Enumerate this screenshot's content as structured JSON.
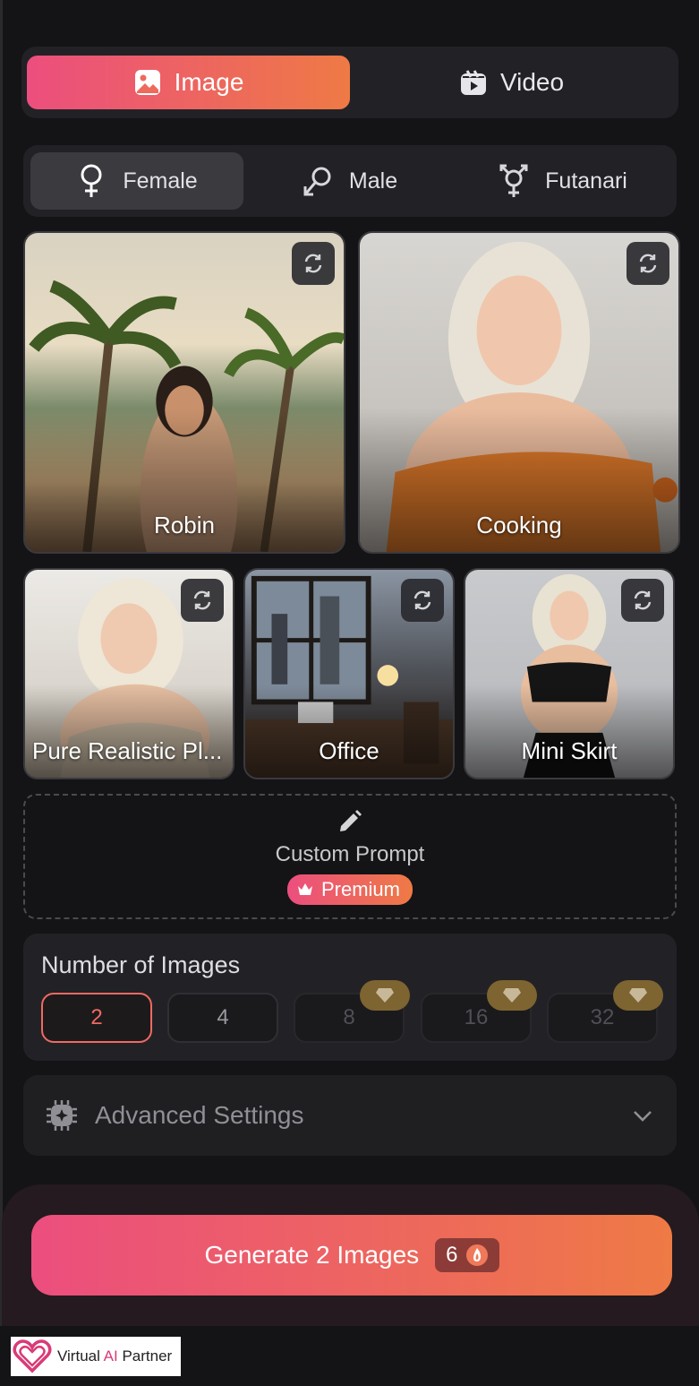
{
  "mode_tabs": [
    {
      "label": "Image",
      "icon": "image-icon",
      "active": true
    },
    {
      "label": "Video",
      "icon": "video-clapper-icon",
      "active": false
    }
  ],
  "gender_tabs": [
    {
      "label": "Female",
      "icon": "female-symbol-icon",
      "active": true
    },
    {
      "label": "Male",
      "icon": "male-symbol-icon",
      "active": false
    },
    {
      "label": "Futanari",
      "icon": "intersex-symbol-icon",
      "active": false
    }
  ],
  "presets": [
    {
      "label": "Robin"
    },
    {
      "label": "Cooking"
    },
    {
      "label": "Pure Realistic Pl..."
    },
    {
      "label": "Office"
    },
    {
      "label": "Mini Skirt"
    }
  ],
  "custom_prompt": {
    "label": "Custom Prompt",
    "badge": "Premium"
  },
  "number_of_images": {
    "title": "Number of Images",
    "options": [
      {
        "value": "2",
        "selected": true,
        "locked": false
      },
      {
        "value": "4",
        "selected": false,
        "locked": false
      },
      {
        "value": "8",
        "selected": false,
        "locked": true
      },
      {
        "value": "16",
        "selected": false,
        "locked": true
      },
      {
        "value": "32",
        "selected": false,
        "locked": true
      }
    ]
  },
  "advanced_settings": {
    "label": "Advanced Settings"
  },
  "generate": {
    "label": "Generate 2 Images",
    "cost": "6"
  },
  "watermark": {
    "brand": "Virtual AI Partner"
  },
  "colors": {
    "accent_start": "#ec4e7e",
    "accent_end": "#ee7a45",
    "background": "#141416",
    "panel": "#222226"
  }
}
